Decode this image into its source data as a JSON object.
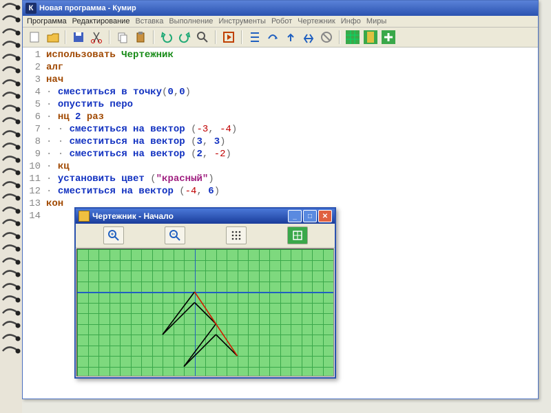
{
  "app": {
    "title": "Новая программа - Кумир",
    "icon_letter": "К"
  },
  "menu": {
    "program": "Программа",
    "edit": "Редактирование",
    "insert": "Вставка",
    "run": "Выполнение",
    "tools": "Инструменты",
    "robot": "Робот",
    "drawer": "Чертежник",
    "info": "Инфо",
    "worlds": "Миры"
  },
  "code": {
    "lines": [
      {
        "n": 1,
        "indent": 0,
        "tokens": [
          [
            "kw",
            "использовать"
          ],
          [
            "sp",
            " "
          ],
          [
            "ident",
            "Чертежник"
          ]
        ]
      },
      {
        "n": 2,
        "indent": 0,
        "tokens": [
          [
            "kw",
            "алг"
          ]
        ]
      },
      {
        "n": 3,
        "indent": 0,
        "tokens": [
          [
            "kw",
            "нач"
          ]
        ]
      },
      {
        "n": 4,
        "indent": 1,
        "tokens": [
          [
            "cmd",
            "сместиться в точку"
          ],
          [
            "punct",
            "("
          ],
          [
            "num",
            "0"
          ],
          [
            "punct",
            ","
          ],
          [
            "num",
            "0"
          ],
          [
            "punct",
            ")"
          ]
        ]
      },
      {
        "n": 5,
        "indent": 1,
        "tokens": [
          [
            "cmd",
            "опустить перо"
          ]
        ]
      },
      {
        "n": 6,
        "indent": 1,
        "tokens": [
          [
            "kw",
            "нц"
          ],
          [
            "sp",
            " "
          ],
          [
            "num",
            "2"
          ],
          [
            "sp",
            " "
          ],
          [
            "kw",
            "раз"
          ]
        ]
      },
      {
        "n": 7,
        "indent": 2,
        "tokens": [
          [
            "cmd",
            "сместиться на вектор"
          ],
          [
            "sp",
            " "
          ],
          [
            "punct",
            "("
          ],
          [
            "neg",
            "-3"
          ],
          [
            "punct",
            ", "
          ],
          [
            "neg",
            "-4"
          ],
          [
            "punct",
            ")"
          ]
        ]
      },
      {
        "n": 8,
        "indent": 2,
        "tokens": [
          [
            "cmd",
            "сместиться на вектор"
          ],
          [
            "sp",
            " "
          ],
          [
            "punct",
            "("
          ],
          [
            "num",
            "3"
          ],
          [
            "punct",
            ", "
          ],
          [
            "num",
            "3"
          ],
          [
            "punct",
            ")"
          ]
        ]
      },
      {
        "n": 9,
        "indent": 2,
        "tokens": [
          [
            "cmd",
            "сместиться на вектор"
          ],
          [
            "sp",
            " "
          ],
          [
            "punct",
            "("
          ],
          [
            "num",
            "2"
          ],
          [
            "punct",
            ", "
          ],
          [
            "neg",
            "-2"
          ],
          [
            "punct",
            ")"
          ]
        ]
      },
      {
        "n": 10,
        "indent": 1,
        "tokens": [
          [
            "kw",
            "кц"
          ]
        ]
      },
      {
        "n": 11,
        "indent": 1,
        "tokens": [
          [
            "cmd",
            "установить цвет"
          ],
          [
            "sp",
            " "
          ],
          [
            "punct",
            "("
          ],
          [
            "str",
            "\"красный\""
          ],
          [
            "punct",
            ")"
          ]
        ]
      },
      {
        "n": 12,
        "indent": 1,
        "tokens": [
          [
            "cmd",
            "сместиться на вектор"
          ],
          [
            "sp",
            " "
          ],
          [
            "punct",
            "("
          ],
          [
            "neg",
            "-4"
          ],
          [
            "punct",
            ", "
          ],
          [
            "num",
            "6"
          ],
          [
            "punct",
            ")"
          ]
        ]
      },
      {
        "n": 13,
        "indent": 0,
        "tokens": [
          [
            "kw",
            "кон"
          ]
        ]
      },
      {
        "n": 14,
        "indent": 0,
        "tokens": []
      }
    ]
  },
  "drawer": {
    "title": "Чертежник - Начало",
    "grid": {
      "cols": 24,
      "rows": 12,
      "cell": 15.5
    },
    "origin": {
      "col": 11,
      "row": 4
    },
    "segments": [
      {
        "from": [
          0,
          0
        ],
        "to": [
          -3,
          -4
        ],
        "color": "#000"
      },
      {
        "from": [
          -3,
          -4
        ],
        "to": [
          0,
          -1
        ],
        "color": "#000"
      },
      {
        "from": [
          0,
          -1
        ],
        "to": [
          2,
          -3
        ],
        "color": "#000"
      },
      {
        "from": [
          2,
          -3
        ],
        "to": [
          -1,
          -7
        ],
        "color": "#000"
      },
      {
        "from": [
          -1,
          -7
        ],
        "to": [
          2,
          -4
        ],
        "color": "#000"
      },
      {
        "from": [
          2,
          -4
        ],
        "to": [
          4,
          -6
        ],
        "color": "#000"
      },
      {
        "from": [
          4,
          -6
        ],
        "to": [
          0,
          0
        ],
        "color": "#d02000"
      }
    ]
  },
  "toolbar_icons": [
    "new",
    "open",
    "save",
    "cut",
    "copy",
    "paste",
    "undo",
    "redo",
    "find",
    "run-step",
    "run-into",
    "step-over",
    "step-out",
    "stop",
    "reset",
    "grid-green",
    "grid-yellow",
    "grid-plus"
  ]
}
